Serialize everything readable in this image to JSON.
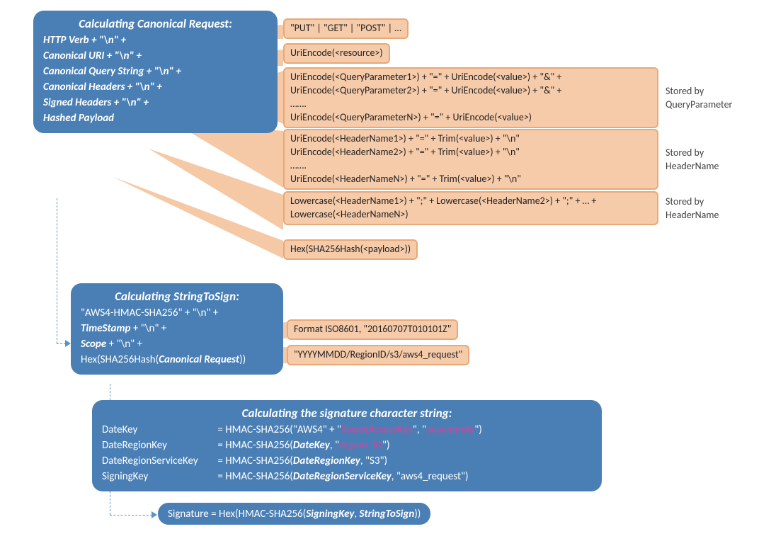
{
  "box1": {
    "title": "Calculating Canonical Request:",
    "l1": "HTTP Verb + \"\\n\" +",
    "l2": "Canonical URI + \"\\n\" +",
    "l3": "Canonical Query String + \"\\n\" +",
    "l4": "Canonical Headers + \"\\n\" +",
    "l5": "Signed Headers + \"\\n\" +",
    "l6": "Hashed Payload"
  },
  "orange1": "\"PUT\" | \"GET\" | \"POST\" | …",
  "orange2": "UriEncode(<resource>)",
  "orange3": "UriEncode(<QueryParameter1>) + \"=\" + UriEncode(<value>) + \"&\" +\nUriEncode(<QueryParameter2>) + \"=\" + UriEncode(<value>) + \"&\" +\n…….\nUriEncode(<QueryParameterN>) + \"=\" + UriEncode(<value>)",
  "orange4": "UriEncode(<HeaderName1>) + \"=\" + Trim(<value>) + \"\\n\"\nUriEncode(<HeaderName2>) + \"=\" + Trim(<value>) + \"\\n\"\n…….\nUriEncode(<HeaderNameN>) + \"=\" + Trim(<value>) +  \"\\n\"",
  "orange5": "Lowercase(<HeaderName1>) + \";\" + Lowercase(<HeaderName2>) + \";\" + … + Lowercase(<HeaderNameN>)",
  "orange6": "Hex(SHA256Hash(<payload>))",
  "side1": "Stored by QueryParameter",
  "side2": "Stored by HeaderName",
  "side3": "Stored by HeaderName",
  "box2": {
    "title": "Calculating StringToSign:",
    "l1": "\"AWS4-HMAC-SHA256\" + \"\\n\" +",
    "l2_a": "TimeStamp",
    "l2_b": " + \"\\n\" +",
    "l3_a": "Scope",
    "l3_b": " + \"\\n\" +",
    "l4_a": "Hex(SHA256Hash(",
    "l4_b": "Canonical Request",
    "l4_c": "))"
  },
  "orange7": "Format ISO8601, \"20160707T010101Z\"",
  "orange8": "\"YYYYMMDD/RegionID/s3/aws4_request\"",
  "box3": {
    "title": "Calculating the signature character string:",
    "r1_k": "DateKey",
    "r1_v1": " = HMAC-SHA256(\"AWS4\" + \"",
    "r1_p1": "SecretAccessKey",
    "r1_v2": "\", \"",
    "r1_p2": "yyyymmdd",
    "r1_v3": "\")",
    "r2_k": "DateRegionKey",
    "r2_v1": " = HMAC-SHA256(",
    "r2_e1": "DateKey",
    "r2_v2": ", \"",
    "r2_p1": "region_ID",
    "r2_v3": "\")",
    "r3_k": "DateRegionServiceKey",
    "r3_v1": " = HMAC-SHA256(",
    "r3_e1": "DateRegionKey",
    "r3_v2": ", \"S3\")",
    "r4_k": "SigningKey",
    "r4_v1": " = HMAC-SHA256(",
    "r4_e1": "DateRegionServiceKey",
    "r4_v2": ", \"aws4_request\")"
  },
  "box4": {
    "a": "Signature = Hex(HMAC-SHA256(",
    "b": "SigningKey",
    "c": ", ",
    "d": "StringToSign",
    "e": "))"
  }
}
